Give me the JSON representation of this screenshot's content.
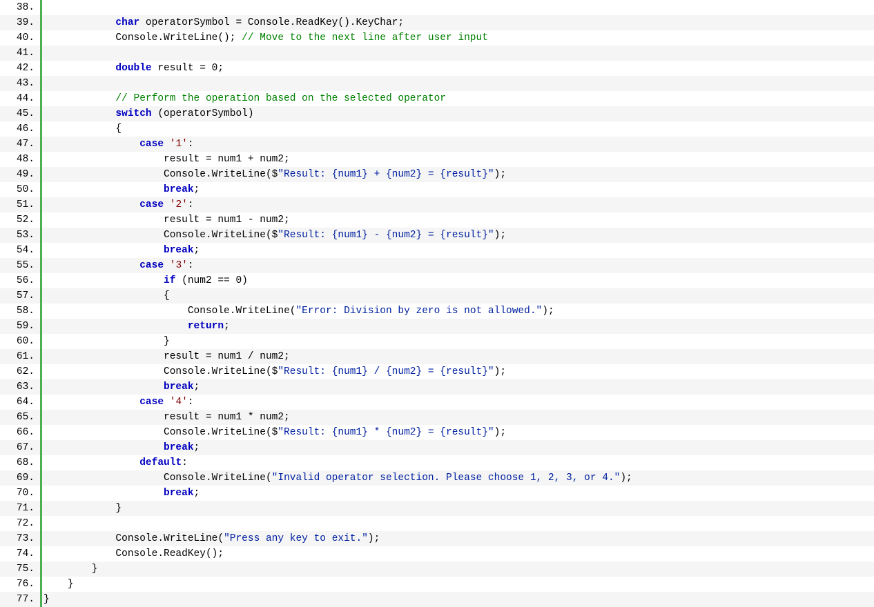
{
  "startLine": 38,
  "lines": [
    {
      "indent": 12,
      "tokens": []
    },
    {
      "indent": 12,
      "tokens": [
        {
          "t": "kw",
          "v": "char"
        },
        {
          "t": "p",
          "v": " operatorSymbol = Console.ReadKey().KeyChar;"
        }
      ]
    },
    {
      "indent": 12,
      "tokens": [
        {
          "t": "p",
          "v": "Console.WriteLine(); "
        },
        {
          "t": "cm",
          "v": "// Move to the next line after user input"
        }
      ]
    },
    {
      "indent": 12,
      "tokens": []
    },
    {
      "indent": 12,
      "tokens": [
        {
          "t": "kw",
          "v": "double"
        },
        {
          "t": "p",
          "v": " result = 0;"
        }
      ]
    },
    {
      "indent": 12,
      "tokens": []
    },
    {
      "indent": 12,
      "tokens": [
        {
          "t": "cm",
          "v": "// Perform the operation based on the selected operator"
        }
      ]
    },
    {
      "indent": 12,
      "tokens": [
        {
          "t": "kw",
          "v": "switch"
        },
        {
          "t": "p",
          "v": " (operatorSymbol)"
        }
      ]
    },
    {
      "indent": 12,
      "tokens": [
        {
          "t": "p",
          "v": "{"
        }
      ]
    },
    {
      "indent": 16,
      "tokens": [
        {
          "t": "kw",
          "v": "case"
        },
        {
          "t": "p",
          "v": " "
        },
        {
          "t": "ch",
          "v": "'1'"
        },
        {
          "t": "p",
          "v": ":"
        }
      ]
    },
    {
      "indent": 20,
      "tokens": [
        {
          "t": "p",
          "v": "result = num1 + num2;"
        }
      ]
    },
    {
      "indent": 20,
      "tokens": [
        {
          "t": "p",
          "v": "Console.WriteLine($"
        },
        {
          "t": "str",
          "v": "\"Result: {num1} + {num2} = {result}\""
        },
        {
          "t": "p",
          "v": ");"
        }
      ]
    },
    {
      "indent": 20,
      "tokens": [
        {
          "t": "kw",
          "v": "break"
        },
        {
          "t": "p",
          "v": ";"
        }
      ]
    },
    {
      "indent": 16,
      "tokens": [
        {
          "t": "kw",
          "v": "case"
        },
        {
          "t": "p",
          "v": " "
        },
        {
          "t": "ch",
          "v": "'2'"
        },
        {
          "t": "p",
          "v": ":"
        }
      ]
    },
    {
      "indent": 20,
      "tokens": [
        {
          "t": "p",
          "v": "result = num1 - num2;"
        }
      ]
    },
    {
      "indent": 20,
      "tokens": [
        {
          "t": "p",
          "v": "Console.WriteLine($"
        },
        {
          "t": "str",
          "v": "\"Result: {num1} - {num2} = {result}\""
        },
        {
          "t": "p",
          "v": ");"
        }
      ]
    },
    {
      "indent": 20,
      "tokens": [
        {
          "t": "kw",
          "v": "break"
        },
        {
          "t": "p",
          "v": ";"
        }
      ]
    },
    {
      "indent": 16,
      "tokens": [
        {
          "t": "kw",
          "v": "case"
        },
        {
          "t": "p",
          "v": " "
        },
        {
          "t": "ch",
          "v": "'3'"
        },
        {
          "t": "p",
          "v": ":"
        }
      ]
    },
    {
      "indent": 20,
      "tokens": [
        {
          "t": "kw",
          "v": "if"
        },
        {
          "t": "p",
          "v": " (num2 == 0)"
        }
      ]
    },
    {
      "indent": 20,
      "tokens": [
        {
          "t": "p",
          "v": "{"
        }
      ]
    },
    {
      "indent": 24,
      "tokens": [
        {
          "t": "p",
          "v": "Console.WriteLine("
        },
        {
          "t": "str",
          "v": "\"Error: Division by zero is not allowed.\""
        },
        {
          "t": "p",
          "v": ");"
        }
      ]
    },
    {
      "indent": 24,
      "tokens": [
        {
          "t": "kw",
          "v": "return"
        },
        {
          "t": "p",
          "v": ";"
        }
      ]
    },
    {
      "indent": 20,
      "tokens": [
        {
          "t": "p",
          "v": "}"
        }
      ]
    },
    {
      "indent": 20,
      "tokens": [
        {
          "t": "p",
          "v": "result = num1 / num2;"
        }
      ]
    },
    {
      "indent": 20,
      "tokens": [
        {
          "t": "p",
          "v": "Console.WriteLine($"
        },
        {
          "t": "str",
          "v": "\"Result: {num1} / {num2} = {result}\""
        },
        {
          "t": "p",
          "v": ");"
        }
      ]
    },
    {
      "indent": 20,
      "tokens": [
        {
          "t": "kw",
          "v": "break"
        },
        {
          "t": "p",
          "v": ";"
        }
      ]
    },
    {
      "indent": 16,
      "tokens": [
        {
          "t": "kw",
          "v": "case"
        },
        {
          "t": "p",
          "v": " "
        },
        {
          "t": "ch",
          "v": "'4'"
        },
        {
          "t": "p",
          "v": ":"
        }
      ]
    },
    {
      "indent": 20,
      "tokens": [
        {
          "t": "p",
          "v": "result = num1 * num2;"
        }
      ]
    },
    {
      "indent": 20,
      "tokens": [
        {
          "t": "p",
          "v": "Console.WriteLine($"
        },
        {
          "t": "str",
          "v": "\"Result: {num1} * {num2} = {result}\""
        },
        {
          "t": "p",
          "v": ");"
        }
      ]
    },
    {
      "indent": 20,
      "tokens": [
        {
          "t": "kw",
          "v": "break"
        },
        {
          "t": "p",
          "v": ";"
        }
      ]
    },
    {
      "indent": 16,
      "tokens": [
        {
          "t": "kw",
          "v": "default"
        },
        {
          "t": "p",
          "v": ":"
        }
      ]
    },
    {
      "indent": 20,
      "tokens": [
        {
          "t": "p",
          "v": "Console.WriteLine("
        },
        {
          "t": "str",
          "v": "\"Invalid operator selection. Please choose 1, 2, 3, or 4.\""
        },
        {
          "t": "p",
          "v": ");"
        }
      ]
    },
    {
      "indent": 20,
      "tokens": [
        {
          "t": "kw",
          "v": "break"
        },
        {
          "t": "p",
          "v": ";"
        }
      ]
    },
    {
      "indent": 12,
      "tokens": [
        {
          "t": "p",
          "v": "}"
        }
      ]
    },
    {
      "indent": 12,
      "tokens": []
    },
    {
      "indent": 12,
      "tokens": [
        {
          "t": "p",
          "v": "Console.WriteLine("
        },
        {
          "t": "str",
          "v": "\"Press any key to exit.\""
        },
        {
          "t": "p",
          "v": ");"
        }
      ]
    },
    {
      "indent": 12,
      "tokens": [
        {
          "t": "p",
          "v": "Console.ReadKey();"
        }
      ]
    },
    {
      "indent": 8,
      "tokens": [
        {
          "t": "p",
          "v": "}"
        }
      ]
    },
    {
      "indent": 4,
      "tokens": [
        {
          "t": "p",
          "v": "}"
        }
      ]
    },
    {
      "indent": 0,
      "tokens": [
        {
          "t": "p",
          "v": "}"
        }
      ]
    }
  ]
}
